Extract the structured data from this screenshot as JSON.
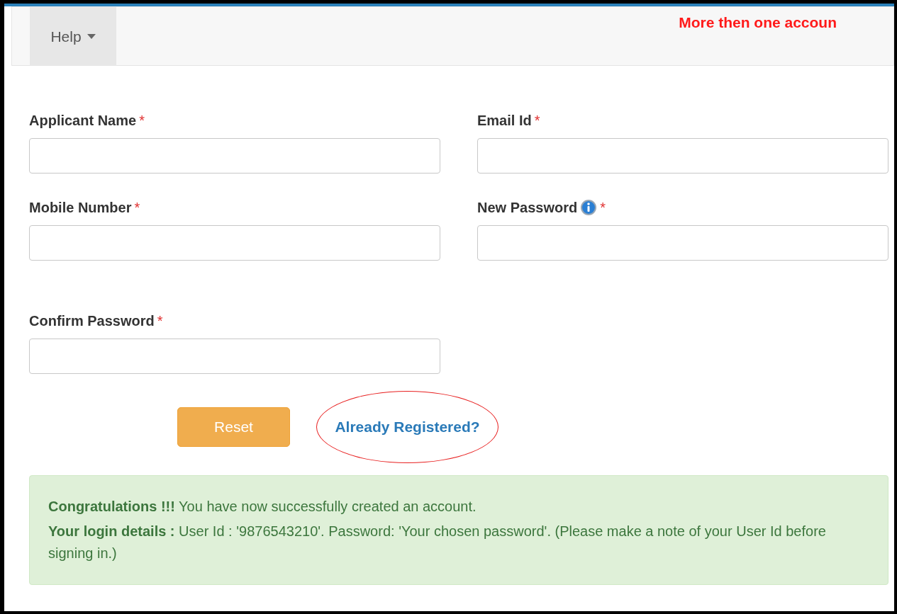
{
  "navbar": {
    "menu": {
      "label": "Help"
    },
    "notice": "More then one accoun"
  },
  "form": {
    "rows": [
      [
        {
          "label": "Applicant Name",
          "required_mark": "*",
          "info": false
        },
        {
          "label": "Email Id",
          "required_mark": "*",
          "info": false
        }
      ],
      [
        {
          "label": "Mobile Number",
          "required_mark": "*",
          "info": false
        },
        {
          "label": "New Password",
          "required_mark": "*",
          "info": true
        }
      ],
      [
        {
          "label": "Confirm Password",
          "required_mark": "*",
          "info": false
        }
      ]
    ]
  },
  "reset_button": "Reset",
  "login_link": "Already Registered?",
  "alert": {
    "lines": [
      "**Congratulations !!!** You have now successfully created an account.",
      "**Your login details :** User Id : '9876543210'. Password: 'Your chosen password'. (Please make a note of your User Id before signing in.)"
    ]
  }
}
